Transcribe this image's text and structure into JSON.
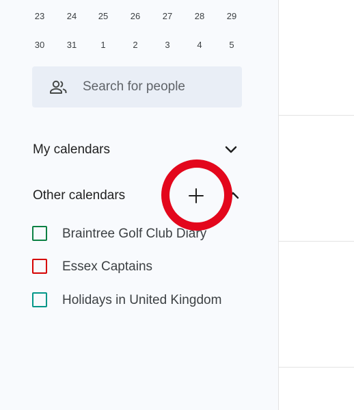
{
  "calendar": {
    "week1": [
      "23",
      "24",
      "25",
      "26",
      "27",
      "28",
      "29"
    ],
    "week2": [
      "30",
      "31",
      "1",
      "2",
      "3",
      "4",
      "5"
    ]
  },
  "search": {
    "label": "Search for people",
    "icon": "people-icon"
  },
  "my_calendars": {
    "label": "My calendars",
    "icon": "chevron-down-icon"
  },
  "other_calendars": {
    "label": "Other calendars",
    "add_icon": "plus-icon",
    "collapse_icon": "chevron-up-icon",
    "items": [
      {
        "label": "Braintree Golf Club Diary",
        "color": "#0b8043"
      },
      {
        "label": "Essex Captains",
        "color": "#d50000"
      },
      {
        "label": "Holidays in United Kingdom",
        "color": "#009688"
      }
    ]
  },
  "colors": {
    "annotation": "#e3071c",
    "sidebar_bg": "#f8fafd",
    "search_bg": "#e9eef6"
  }
}
